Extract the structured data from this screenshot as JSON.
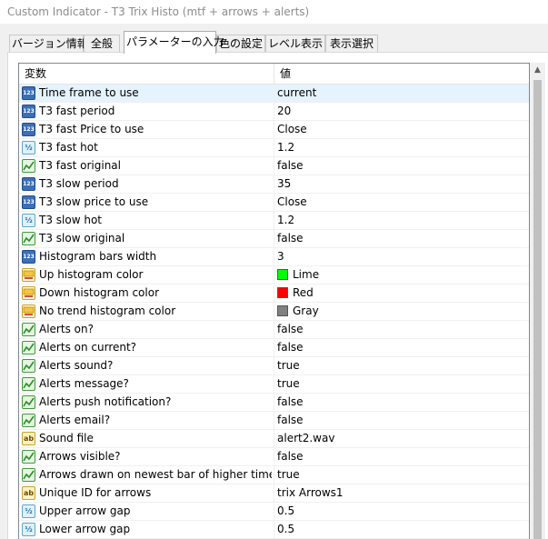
{
  "window": {
    "title": "Custom Indicator - T3 Trix Histo (mtf + arrows + alerts)"
  },
  "tabs": [
    {
      "label": "バージョン情報",
      "active": false
    },
    {
      "label": "全般",
      "active": false
    },
    {
      "label": "パラメーターの入力",
      "active": true
    },
    {
      "label": "色の設定",
      "active": false
    },
    {
      "label": "レベル表示",
      "active": false
    },
    {
      "label": "表示選択",
      "active": false
    }
  ],
  "grid": {
    "columns": {
      "name": "変数",
      "value": "値"
    },
    "rows": [
      {
        "type": "int",
        "icon": "integer-icon",
        "name": "Time frame to use",
        "value": "current",
        "selected": true
      },
      {
        "type": "int",
        "icon": "integer-icon",
        "name": "T3 fast period",
        "value": "20"
      },
      {
        "type": "enm",
        "icon": "enum-icon",
        "name": "T3 fast Price to use",
        "value": "Close"
      },
      {
        "type": "dbl",
        "icon": "double-icon",
        "name": "T3 fast hot",
        "value": "1.2"
      },
      {
        "type": "bool",
        "icon": "bool-icon",
        "name": "T3 fast original",
        "value": "false"
      },
      {
        "type": "int",
        "icon": "integer-icon",
        "name": "T3 slow period",
        "value": "35"
      },
      {
        "type": "enm",
        "icon": "enum-icon",
        "name": "T3 slow price to use",
        "value": "Close"
      },
      {
        "type": "dbl",
        "icon": "double-icon",
        "name": "T3 slow hot",
        "value": "1.2"
      },
      {
        "type": "bool",
        "icon": "bool-icon",
        "name": "T3 slow original",
        "value": "false"
      },
      {
        "type": "int",
        "icon": "integer-icon",
        "name": "Histogram bars width",
        "value": "3"
      },
      {
        "type": "color",
        "icon": "color-icon",
        "name": "Up histogram color",
        "value": "Lime",
        "swatch": "#00ff00"
      },
      {
        "type": "color",
        "icon": "color-icon",
        "name": "Down histogram color",
        "value": "Red",
        "swatch": "#ff0000"
      },
      {
        "type": "color",
        "icon": "color-icon",
        "name": "No trend histogram color",
        "value": "Gray",
        "swatch": "#808080"
      },
      {
        "type": "bool",
        "icon": "bool-icon",
        "name": "Alerts on?",
        "value": "false"
      },
      {
        "type": "bool",
        "icon": "bool-icon",
        "name": "Alerts on current?",
        "value": "false"
      },
      {
        "type": "bool",
        "icon": "bool-icon",
        "name": "Alerts sound?",
        "value": "true"
      },
      {
        "type": "bool",
        "icon": "bool-icon",
        "name": "Alerts message?",
        "value": "true"
      },
      {
        "type": "bool",
        "icon": "bool-icon",
        "name": "Alerts push notification?",
        "value": "false"
      },
      {
        "type": "bool",
        "icon": "bool-icon",
        "name": "Alerts email?",
        "value": "false"
      },
      {
        "type": "str",
        "icon": "string-icon",
        "name": "Sound file",
        "value": "alert2.wav"
      },
      {
        "type": "bool",
        "icon": "bool-icon",
        "name": "Arrows visible?",
        "value": "false"
      },
      {
        "type": "bool",
        "icon": "bool-icon",
        "name": "Arrows drawn on newest bar of higher time fra...",
        "value": "true"
      },
      {
        "type": "str",
        "icon": "string-icon",
        "name": "Unique ID for arrows",
        "value": "trix Arrows1"
      },
      {
        "type": "dbl",
        "icon": "double-icon",
        "name": "Upper arrow gap",
        "value": "0.5"
      },
      {
        "type": "dbl",
        "icon": "double-icon",
        "name": "Lower arrow gap",
        "value": "0.5"
      }
    ]
  },
  "icon_glyphs": {
    "int": "123",
    "enm": "123",
    "dbl": "½",
    "str": "ab"
  },
  "colors": {
    "selected_row": "#e5f3ff",
    "grid_border": "#828790"
  }
}
